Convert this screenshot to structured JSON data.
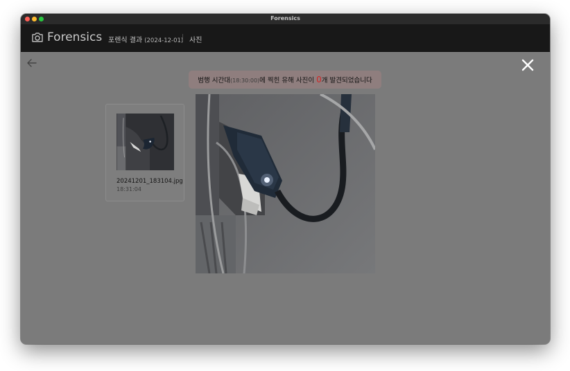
{
  "window": {
    "title": "Forensics"
  },
  "header": {
    "brand": "Forensics",
    "nav_result_label": "포렌식 결과",
    "nav_result_date": "(2024-12-01)",
    "nav_photos_label": "사진"
  },
  "banner": {
    "prefix": "범행 시간대",
    "time": "(18:30:00)",
    "middle": "에 찍힌 유해 사진이 ",
    "count": "0",
    "suffix": "개 발견되었습니다",
    "count_color": "#d12525"
  },
  "photos": [
    {
      "filename": "20241201_183104.jpg",
      "time": "18:31:04"
    }
  ],
  "icons": {
    "logo": "camera-icon",
    "back": "arrow-left-icon",
    "close": "close-icon"
  },
  "colors": {
    "overlay": "#7b7b7b",
    "appbar": "#181818",
    "banner": "#8f7e7e"
  }
}
